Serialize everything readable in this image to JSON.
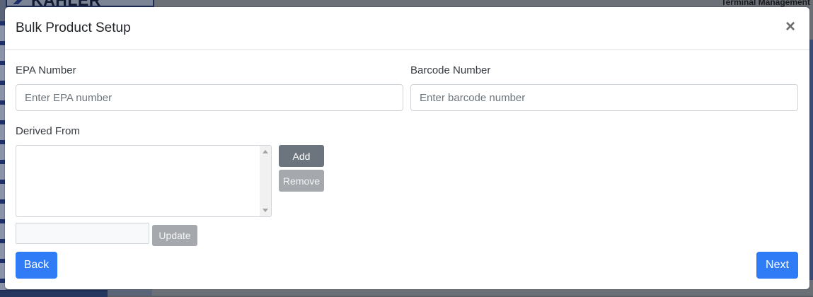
{
  "background": {
    "logo_text": "KAHLER",
    "top_right_text": "Terminal Management"
  },
  "modal": {
    "title": "Bulk Product Setup",
    "close_glyph": "×",
    "epa": {
      "label": "EPA Number",
      "placeholder": "Enter EPA number",
      "value": ""
    },
    "barcode": {
      "label": "Barcode Number",
      "placeholder": "Enter barcode number",
      "value": ""
    },
    "derived_from": {
      "label": "Derived From",
      "items": []
    },
    "add_label": "Add",
    "remove_label": "Remove",
    "update_input_value": "",
    "update_label": "Update",
    "back_label": "Back",
    "next_label": "Next"
  },
  "colors": {
    "primary": "#2f7cf6",
    "secondary": "#6c757d",
    "disabled": "#a5a9ae"
  }
}
